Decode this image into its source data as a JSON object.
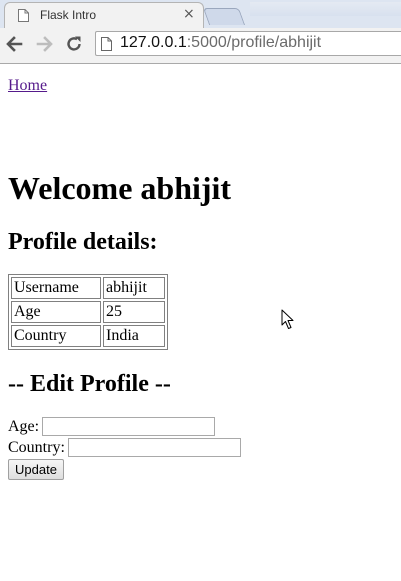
{
  "browser": {
    "tab_title": "Flask Intro",
    "tab_close": "×",
    "url_host": "127.0.0.1",
    "url_path": ":5000/profile/abhijit"
  },
  "page": {
    "home_link": "Home",
    "welcome_heading": "Welcome abhijit",
    "profile_heading": "Profile details:",
    "profile_table": [
      {
        "key": "Username",
        "value": "abhijit"
      },
      {
        "key": "Age",
        "value": "25"
      },
      {
        "key": "Country",
        "value": "India"
      }
    ],
    "edit_heading": "-- Edit Profile --",
    "form": {
      "age_label": "Age:",
      "age_value": "",
      "country_label": "Country:",
      "country_value": "",
      "submit_label": "Update"
    }
  },
  "colors": {
    "link_visited": "#551a8b",
    "tab_strip": "#dde5f1",
    "toolbar": "#f2f2f2"
  }
}
